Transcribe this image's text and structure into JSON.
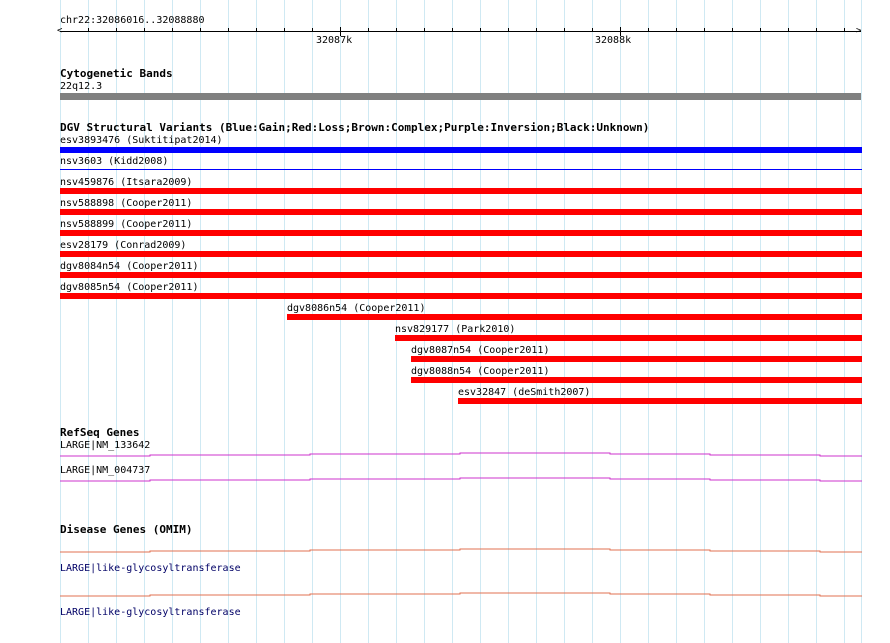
{
  "ruler": {
    "region": "chr22:32086016..32088880",
    "tick_labels": [
      "32087k",
      "32088k"
    ]
  },
  "cytoband": {
    "title": "Cytogenetic Bands",
    "band": "22q12.3",
    "band_color": "#808080"
  },
  "dgv": {
    "title": "DGV Structural Variants (Blue:Gain;Red:Loss;Brown:Complex;Purple:Inversion;Black:Unknown)",
    "colors": {
      "gain": "#0000ff",
      "loss": "#ff0000"
    },
    "variants": [
      {
        "label": "esv3893476 (Suktitipat2014)",
        "type": "gain"
      },
      {
        "label": "nsv3603 (Kidd2008)",
        "type": "gain"
      },
      {
        "label": "nsv459876 (Itsara2009)",
        "type": "loss"
      },
      {
        "label": "nsv588898 (Cooper2011)",
        "type": "loss"
      },
      {
        "label": "nsv588899 (Cooper2011)",
        "type": "loss"
      },
      {
        "label": "esv28179 (Conrad2009)",
        "type": "loss"
      },
      {
        "label": "dgv8084n54 (Cooper2011)",
        "type": "loss"
      },
      {
        "label": "dgv8085n54 (Cooper2011)",
        "type": "loss"
      },
      {
        "label": "dgv8086n54 (Cooper2011)",
        "type": "loss"
      },
      {
        "label": "nsv829177 (Park2010)",
        "type": "loss"
      },
      {
        "label": "dgv8087n54 (Cooper2011)",
        "type": "loss"
      },
      {
        "label": "dgv8088n54 (Cooper2011)",
        "type": "loss"
      },
      {
        "label": "esv32847 (deSmith2007)",
        "type": "loss"
      }
    ]
  },
  "refseq": {
    "title": "RefSeq Genes",
    "color": "#cc33cc",
    "genes": [
      {
        "label": "LARGE|NM_133642"
      },
      {
        "label": "LARGE|NM_004737"
      }
    ]
  },
  "omim": {
    "title": "Disease Genes (OMIM)",
    "color": "#e07050",
    "genes": [
      {
        "label": "LARGE|like-glycosyltransferase"
      },
      {
        "label": "LARGE|like-glycosyltransferase"
      }
    ]
  }
}
